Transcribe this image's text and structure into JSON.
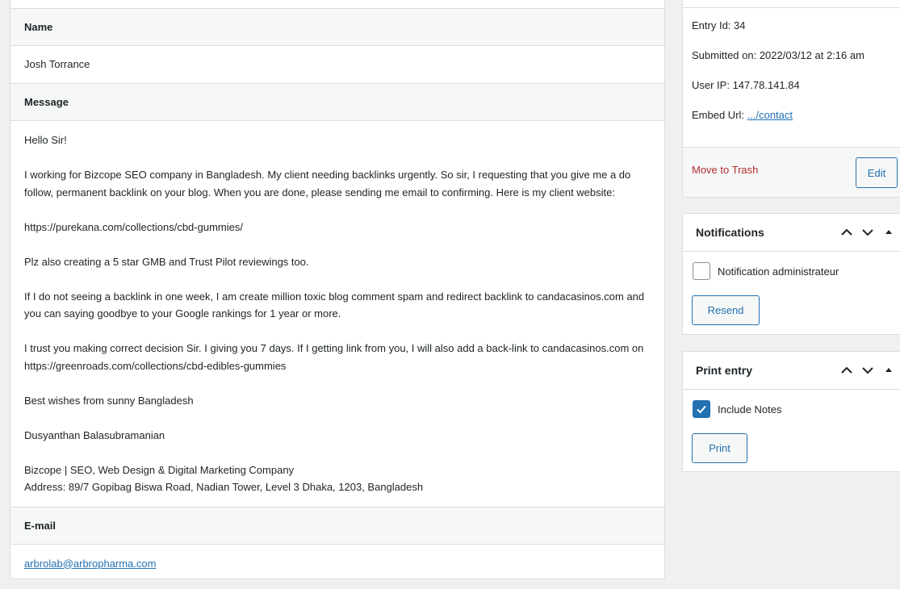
{
  "entry": {
    "fields": [
      {
        "label": "Name",
        "value": "Josh Torrance"
      },
      {
        "label": "Message",
        "paragraphs": [
          "Hello Sir!",
          "I working for Bizcope SEO company in Bangladesh. My client needing backlinks urgently. So sir, I requesting that you give me a do follow, permanent backlink on your blog. When you are done, please sending me email to confirming. Here is my client website:",
          "https://purekana.com/collections/cbd-gummies/",
          "Plz also creating a 5 star GMB and Trust Pilot reviewings too.",
          "If I do not seeing a backlink in one week, I am create million toxic blog comment spam and redirect backlink to candacasinos.com and you can saying goodbye to your Google rankings for 1 year or more.",
          "I trust you making correct decision Sir. I giving you 7 days. If I getting link from you, I will also add a back-link to candacasinos.com on https://greenroads.com/collections/cbd-edibles-gummies",
          "Best wishes from sunny Bangladesh",
          "Dusyanthan Balasubramanian",
          "Bizcope | SEO, Web Design & Digital Marketing Company",
          "Address: 89/7 Gopibag Biswa Road, Nadian Tower, Level 3 Dhaka, 1203, Bangladesh"
        ]
      },
      {
        "label": "E-mail",
        "value": "arbrolab@arbropharma.com"
      }
    ]
  },
  "sidebar": {
    "info": {
      "entry_id": "Entry Id: 34",
      "submitted": "Submitted on: 2022/03/12 at 2:16 am",
      "user_ip": "User IP: 147.78.141.84",
      "embed_label": "Embed Url: ",
      "embed_link": ".../contact",
      "trash": "Move to Trash",
      "edit": "Edit"
    },
    "notifications": {
      "title": "Notifications",
      "option": "Notification administrateur",
      "checked": false,
      "button": "Resend"
    },
    "print": {
      "title": "Print entry",
      "option": "Include Notes",
      "checked": true,
      "button": "Print"
    }
  },
  "colors": {
    "accent": "#2271b1",
    "danger": "#b32d2e",
    "background": "#f0f0f1"
  }
}
